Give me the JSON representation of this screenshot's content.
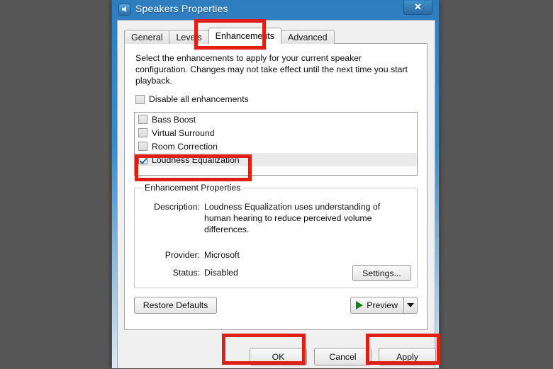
{
  "window": {
    "title": "Speakers Properties",
    "icon": "speaker-icon",
    "close_label": "✕",
    "accent_color": "#2e7dbf",
    "highlight_color": "#e01f14",
    "desktop_background": "#565656"
  },
  "tabs": [
    {
      "label": "General",
      "active": false
    },
    {
      "label": "Levels",
      "active": false
    },
    {
      "label": "Enhancements",
      "active": true
    },
    {
      "label": "Advanced",
      "active": false
    }
  ],
  "page": {
    "intro": "Select the enhancements to apply for your current speaker configuration. Changes may not take effect until the next time you start playback.",
    "disable_all": {
      "label": "Disable all enhancements",
      "checked": false
    },
    "enhancements": [
      {
        "label": "Bass Boost",
        "checked": false,
        "selected": false
      },
      {
        "label": "Virtual Surround",
        "checked": false,
        "selected": false
      },
      {
        "label": "Room Correction",
        "checked": false,
        "selected": false
      },
      {
        "label": "Loudness Equalization",
        "checked": true,
        "selected": true
      }
    ],
    "properties": {
      "group_label": "Enhancement Properties",
      "description_label": "Description:",
      "description_value": "Loudness Equalization uses understanding of human hearing to reduce perceived volume differences.",
      "provider_label": "Provider:",
      "provider_value": "Microsoft",
      "status_label": "Status:",
      "status_value": "Disabled",
      "settings_label": "Settings..."
    },
    "restore_label": "Restore Defaults",
    "preview_label": "Preview",
    "preview_icon": "play-icon",
    "preview_dropdown_icon": "chevron-down-icon"
  },
  "footer": {
    "ok_label": "OK",
    "cancel_label": "Cancel",
    "apply_label": "Apply"
  },
  "annotations": [
    {
      "name": "enhancements-tab-highlight"
    },
    {
      "name": "loudness-equalization-highlight"
    },
    {
      "name": "ok-button-highlight"
    },
    {
      "name": "apply-button-highlight"
    }
  ]
}
